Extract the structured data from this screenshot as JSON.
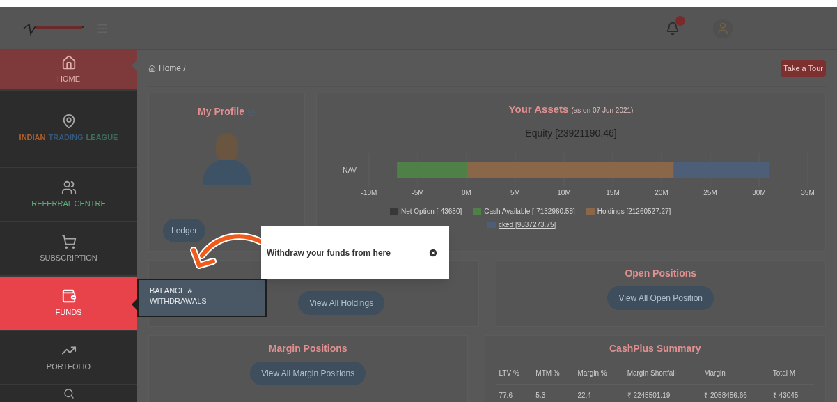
{
  "header": {
    "notification_badge": true
  },
  "sidebar": {
    "items": [
      {
        "kind": "plain",
        "label": "HOME",
        "selected": true,
        "highlighted": false
      },
      {
        "kind": "league",
        "parts": [
          {
            "text": "INDIAN",
            "color": "#b0602c"
          },
          {
            "text": "TRADING",
            "color": "#35587a"
          },
          {
            "text": "LEAGUE",
            "color": "#3a6e5a"
          }
        ],
        "selected": false,
        "highlighted": false
      },
      {
        "kind": "plain",
        "label": "REFERRAL CENTRE",
        "color": "#5fae78",
        "selected": false,
        "highlighted": false
      },
      {
        "kind": "plain",
        "label": "SUBSCRIPTION",
        "selected": false,
        "highlighted": false
      },
      {
        "kind": "plain",
        "label": "FUNDS",
        "selected": false,
        "highlighted": true,
        "submenu": "BALANCE & WITHDRAWALS"
      },
      {
        "kind": "plain",
        "label": "PORTFOLIO",
        "selected": false,
        "highlighted": false
      },
      {
        "kind": "icon_only",
        "selected": false,
        "highlighted": false
      }
    ]
  },
  "breadcrumb": "Home /",
  "tour_button": "Take a Tour",
  "tour_popover": {
    "text": "Withdraw your funds from here"
  },
  "profile": {
    "title": "My Profile",
    "buttons": [
      "Ledger"
    ]
  },
  "assets": {
    "title": "Your Assets",
    "subtitle": "(as on 07 Jun 2021)",
    "chart_data": {
      "type": "bar",
      "legend": "bottom",
      "orientation": "horizontal",
      "stacked": true,
      "title": "Equity [23921190.46]",
      "categories": [
        "NAV"
      ],
      "series": [
        {
          "name": "Net Option [-43650]",
          "color": "#383838",
          "values": [
            null
          ]
        },
        {
          "name": "Cash Available [-7132960.58]",
          "color": "#4e8048",
          "values": [
            -7132960.58
          ]
        },
        {
          "name": "Holdings [21260527.27]",
          "color": "#8a6748",
          "values": [
            21260527.27
          ]
        },
        {
          "name": "cked [9837273.75]",
          "color": "#4d5f78",
          "values": [
            9837273.75
          ]
        }
      ],
      "xlim": [
        -10000000,
        35000000
      ],
      "xticks": [
        {
          "value": -10000000,
          "label": "-10M"
        },
        {
          "value": -5000000,
          "label": "-5M"
        },
        {
          "value": 0,
          "label": "0M"
        },
        {
          "value": 5000000,
          "label": "5M"
        },
        {
          "value": 10000000,
          "label": "10M"
        },
        {
          "value": 15000000,
          "label": "15M"
        },
        {
          "value": 20000000,
          "label": "20M"
        },
        {
          "value": 25000000,
          "label": "25M"
        },
        {
          "value": 30000000,
          "label": "30M"
        },
        {
          "value": 35000000,
          "label": "35M"
        }
      ]
    }
  },
  "holdings": {
    "button": "View All Holdings"
  },
  "open_positions": {
    "title": "Open Positions",
    "button": "View All Open Position"
  },
  "margin_positions": {
    "title": "Margin Positions",
    "button": "View All Margin Positions"
  },
  "cashplus": {
    "title": "CashPlus Summary",
    "columns": [
      "LTV %",
      "MTM %",
      "Margin %",
      "Margin Shortfall",
      "Margin",
      "Total M"
    ],
    "rows": [
      [
        "77.6",
        "5.3",
        "22.4",
        "₹ 2245501.19",
        "₹ 2058456.66",
        "₹ 43045"
      ]
    ]
  }
}
